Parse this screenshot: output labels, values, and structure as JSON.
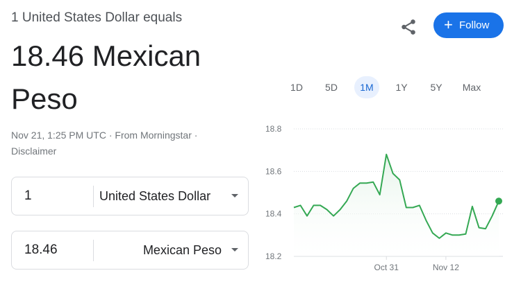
{
  "header": {
    "subtitle": "1 United States Dollar equals",
    "rate_text": "18.46 Mexican Peso"
  },
  "meta": {
    "timestamp": "Nov 21, 1:25 PM UTC",
    "separator": " · ",
    "source": "From Morningstar",
    "sep2": " · ",
    "disclaimer": "Disclaimer"
  },
  "actions": {
    "share_icon": "share-icon",
    "follow_label": "Follow",
    "follow_icon": "+"
  },
  "converter": {
    "from": {
      "amount": "1",
      "currency": "United States Dollar"
    },
    "to": {
      "amount": "18.46",
      "currency": "Mexican Peso"
    }
  },
  "ranges": [
    {
      "label": "1D"
    },
    {
      "label": "5D"
    },
    {
      "label": "1M",
      "active": true
    },
    {
      "label": "1Y"
    },
    {
      "label": "5Y"
    },
    {
      "label": "Max"
    }
  ],
  "chart_data": {
    "type": "area",
    "y_ticks": [
      "18.8",
      "18.6",
      "18.4",
      "18.2"
    ],
    "ylim": [
      18.2,
      18.8
    ],
    "x_ticks": [
      {
        "label": "Oct 31",
        "index": 14
      },
      {
        "label": "Nov 12",
        "index": 23
      }
    ],
    "grid": true,
    "line_color": "#34a853",
    "fill_color": "#e6f4ea",
    "series": [
      {
        "values": [
          18.43,
          18.44,
          18.39,
          18.44,
          18.44,
          18.42,
          18.39,
          18.42,
          18.46,
          18.52,
          18.545,
          18.545,
          18.55,
          18.49,
          18.68,
          18.59,
          18.56,
          18.43,
          18.43,
          18.44,
          18.37,
          18.31,
          18.285,
          18.31,
          18.3,
          18.3,
          18.305,
          18.435,
          18.335,
          18.33,
          18.39,
          18.46
        ]
      }
    ]
  }
}
